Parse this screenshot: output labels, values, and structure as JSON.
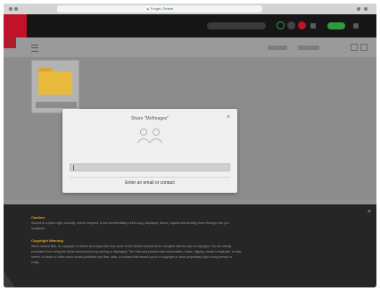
{
  "browser": {
    "url": "▲ Forget, Delete"
  },
  "toolbar": {
    "search_placeholder": "",
    "status_label": ""
  },
  "folder": {
    "name": ""
  },
  "dialog": {
    "title": "Share \"Mr/Images\"",
    "input_placeholder": "",
    "link_label": "Enter an email or contact"
  },
  "banner": {
    "caution_heading": "Caution",
    "caution_lines": [
      "Shared is a cyber-right, security, how to respond, to the confidentiality of the copy, displayed, above, copied and sending them through how you",
      "recipients"
    ],
    "copyright_heading": "Copyright Warning",
    "copyright_lines": [
      "When shared files, be copyright of others and respective that some of the Works should not be complied with the law of copyright. You are strictly",
      "prohibited from using the Works and products by storing or displaying. The view and policies that mixed states, share, display, create a duplicate, or sale",
      "herein, to mimic or other some works published any files, data, or content that breach you in a copyright or other proprietary right of any person or",
      "entity."
    ]
  },
  "colors": {
    "brand_red": "#c0122a",
    "accent_green": "#2f9a3f",
    "folder_yellow": "#e8b93a",
    "warning_orange": "#e2a424"
  }
}
